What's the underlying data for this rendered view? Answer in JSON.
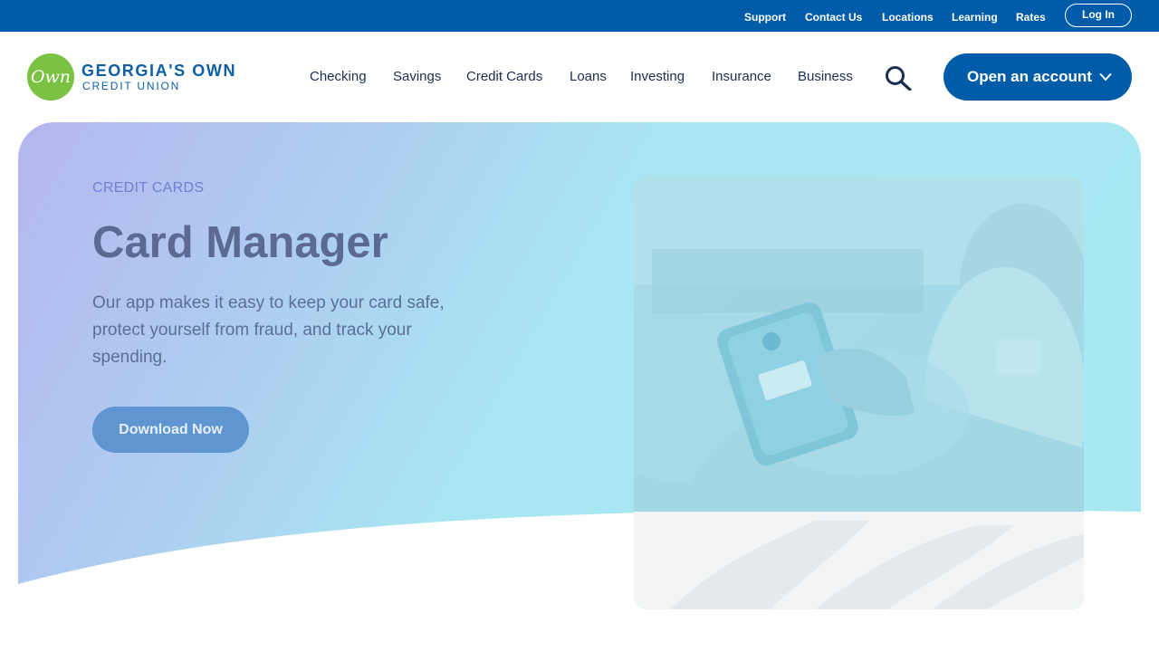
{
  "utility_bar": {
    "links": [
      "Support",
      "Contact Us",
      "Locations",
      "Learning",
      "Rates"
    ],
    "login_label": "Log In"
  },
  "header": {
    "logo": {
      "badge_text": "Own",
      "line1": "GEORGIA'S OWN",
      "line2": "CREDIT UNION"
    },
    "nav": [
      "Checking",
      "Savings",
      "Credit Cards",
      "Loans",
      "Investing",
      "Insurance",
      "Business"
    ],
    "search_icon": "search-icon",
    "cta_label": "Open an account",
    "cta_icon": "chevron-down-icon"
  },
  "hero": {
    "eyebrow": "CREDIT CARDS",
    "title": "Card Manager",
    "description": "Our app makes it easy to keep your card safe, protect yourself from fraud, and track your spending.",
    "button_label": "Download Now"
  },
  "colors": {
    "brand_blue": "#005ca8",
    "logo_green": "#7cc242",
    "hero_gradient_start": "#b5b6ee",
    "hero_gradient_end": "#a7e8f3"
  }
}
